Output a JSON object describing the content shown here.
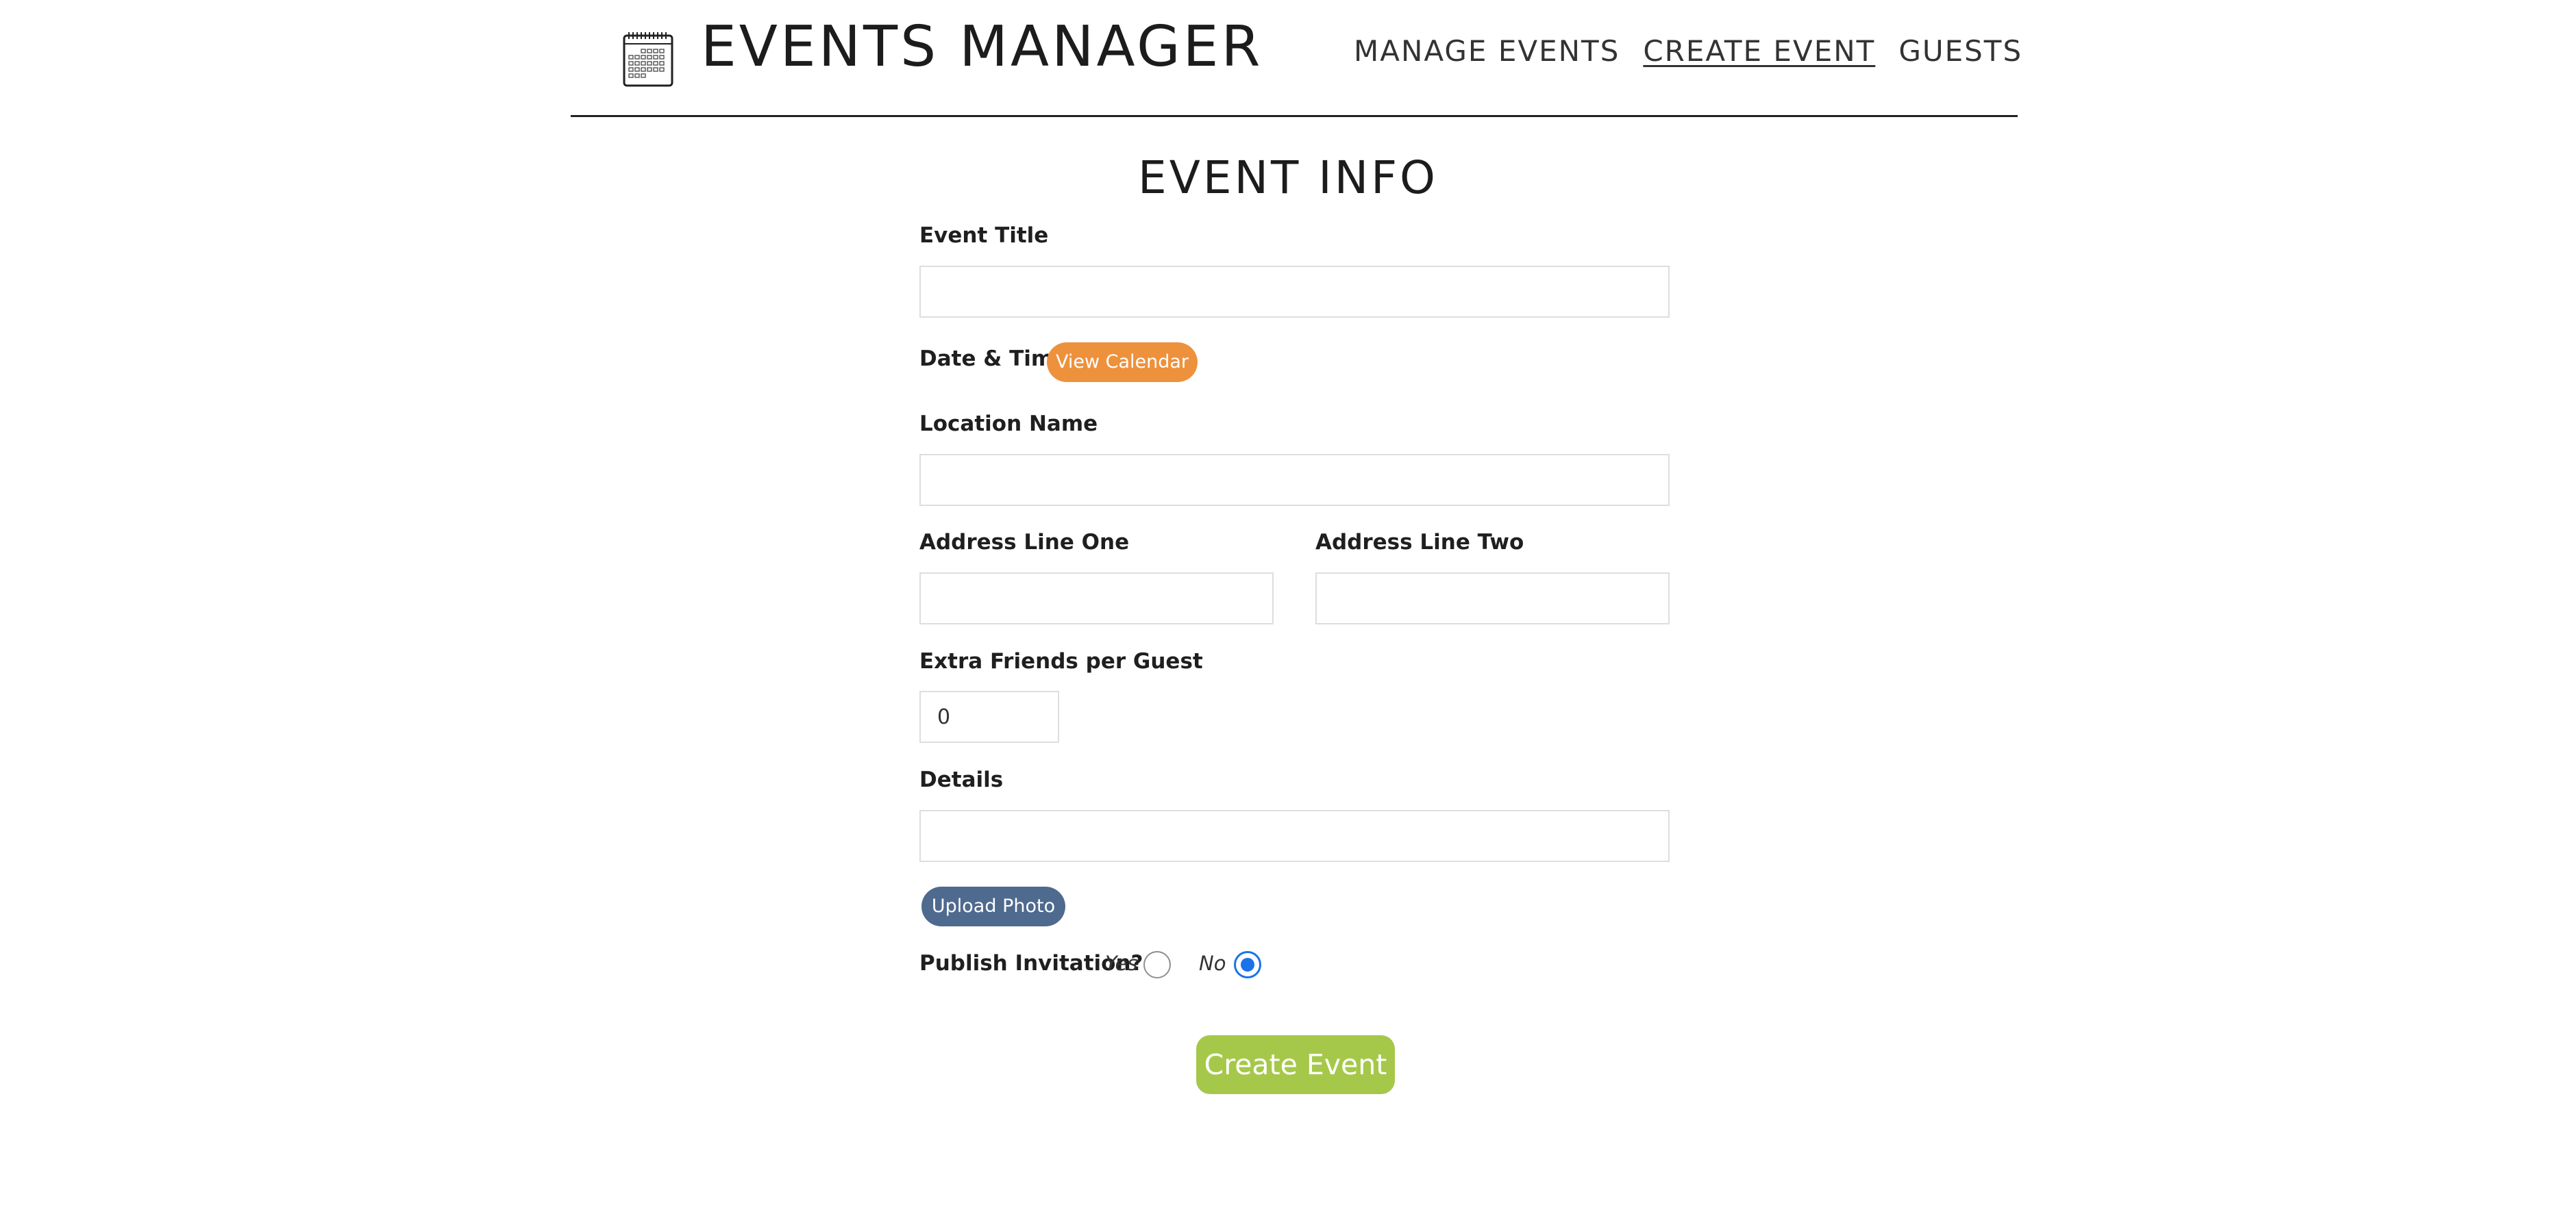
{
  "header": {
    "app_title": "EVENTS MANAGER",
    "logo_icon": "calendar-icon",
    "nav": [
      {
        "label": "MANAGE EVENTS",
        "active": false
      },
      {
        "label": "CREATE EVENT",
        "active": true
      },
      {
        "label": "GUESTS",
        "active": false
      }
    ]
  },
  "form": {
    "title": "EVENT INFO",
    "event_title": {
      "label": "Event Title",
      "value": ""
    },
    "date_time": {
      "label": "Date & Time",
      "button": "View Calendar"
    },
    "location_name": {
      "label": "Location Name",
      "value": ""
    },
    "address_one": {
      "label": "Address Line One",
      "value": ""
    },
    "address_two": {
      "label": "Address Line Two",
      "value": ""
    },
    "extra_friends": {
      "label": "Extra Friends per Guest",
      "value": "0"
    },
    "details": {
      "label": "Details",
      "value": ""
    },
    "upload_button": "Upload Photo",
    "publish": {
      "label": "Publish Invitation?",
      "options": [
        "Yes",
        "No"
      ],
      "selected": "No"
    },
    "submit_label": "Create Event"
  },
  "colors": {
    "calendar_button": "#ee913c",
    "upload_button": "#4e6a8e",
    "submit_button": "#a6c84a",
    "radio_selected": "#1a73e8"
  }
}
